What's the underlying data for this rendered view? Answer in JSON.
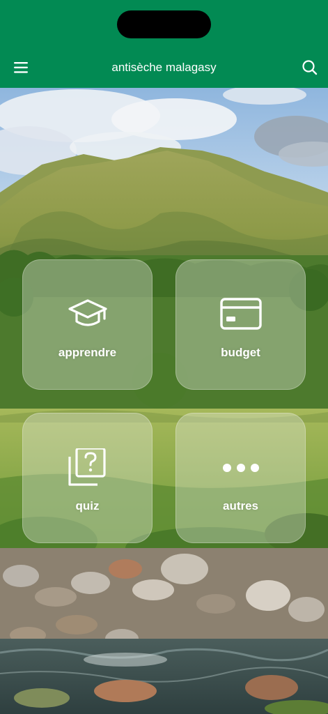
{
  "header": {
    "title": "antisèche malagasy",
    "menu_icon": "hamburger-menu-icon",
    "search_icon": "magnifier-search-icon",
    "bg_color": "#028a53"
  },
  "tiles": [
    {
      "label": "apprendre",
      "icon": "graduation-cap-icon"
    },
    {
      "label": "budget",
      "icon": "credit-card-icon"
    },
    {
      "label": "quiz",
      "icon": "question-cards-icon"
    },
    {
      "label": "autres",
      "icon": "more-dots-icon"
    }
  ]
}
